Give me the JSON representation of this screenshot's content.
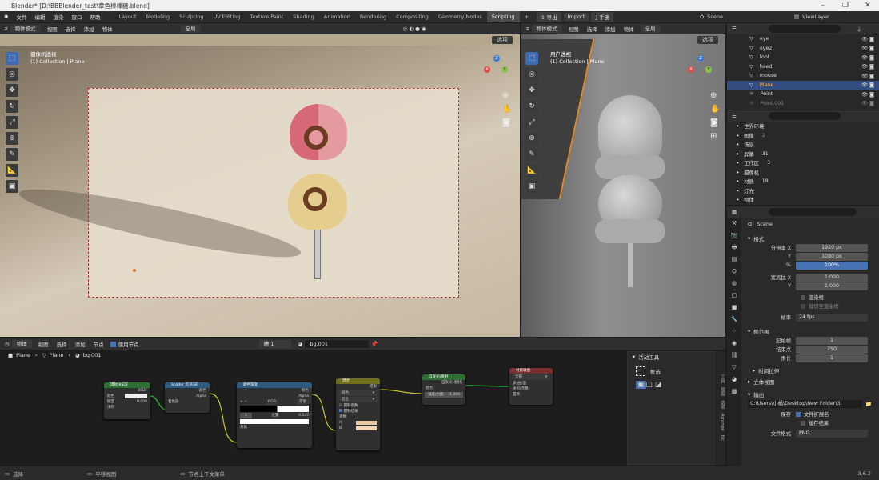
{
  "window": {
    "title": "Blender* [D:\\BBBlender_test\\章鱼棒棒糖.blend]"
  },
  "menu": [
    "文件",
    "编辑",
    "渲染",
    "窗口",
    "帮助"
  ],
  "workspaces": [
    "Layout",
    "Modeling",
    "Sculpting",
    "UV Editing",
    "Texture Paint",
    "Shading",
    "Animation",
    "Rendering",
    "Compositing",
    "Geometry Nodes",
    "Scripting"
  ],
  "active_workspace": "Scripting",
  "topbar": {
    "export": "导出",
    "import": "Import",
    "hand": "手册",
    "scene": "Scene",
    "view_layer": "ViewLayer",
    "add_ws": "+"
  },
  "viewport1": {
    "mode": "物体模式",
    "menus": [
      "视图",
      "选择",
      "添加",
      "物体"
    ],
    "orientation": "全局",
    "options": "选项",
    "view_name": "摄像机透视",
    "collection": "(1) Collection | Plane"
  },
  "viewport2": {
    "mode": "物体模式",
    "menus": [
      "视图",
      "选择",
      "添加",
      "物体"
    ],
    "orientation": "全局",
    "options": "选项",
    "view_name": "用户透视",
    "collection": "(1) Collection | Plane"
  },
  "axes": {
    "x": "X",
    "y": "Y",
    "z": "Z"
  },
  "outliner": {
    "items": [
      {
        "name": "eye",
        "selected": false
      },
      {
        "name": "eye2",
        "selected": false
      },
      {
        "name": "foot",
        "selected": false
      },
      {
        "name": "haed",
        "selected": false
      },
      {
        "name": "mouse",
        "selected": false
      },
      {
        "name": "Plane",
        "selected": true
      },
      {
        "name": "Point",
        "selected": false
      },
      {
        "name": "Point.001",
        "selected": false
      }
    ]
  },
  "data_tree": {
    "items": [
      "世界环境",
      "图像",
      "场景",
      "屏幕",
      "工作区",
      "摄像机",
      "材质",
      "灯光",
      "物体"
    ],
    "counts": [
      "2",
      "",
      "31",
      "3",
      "",
      "18",
      "",
      ""
    ]
  },
  "properties": {
    "scene": "Scene",
    "format_header": "格式",
    "res_x_label": "分辨率 X",
    "res_x": "1920 px",
    "res_y_label": "Y",
    "res_y": "1080 px",
    "pct_label": "%",
    "pct": "100%",
    "aspect_x_label": "宽高比 X",
    "aspect_x": "1.000",
    "aspect_y_label": "Y",
    "aspect_y": "1.000",
    "render_region": "渲染框",
    "crop": "裁切至渲染框",
    "fps_label": "帧率",
    "fps": "24 fps",
    "frame_range_header": "帧范围",
    "start_label": "起始帧",
    "start": "1",
    "end_label": "结束点",
    "end": "250",
    "step_label": "步长",
    "step": "1",
    "time_stretch": "时间拉伸",
    "stereo": "立体视图",
    "output_header": "输出",
    "output_path": "C:\\Users\\小橘\\Desktop\\New Folder\\3",
    "save_label": "保存",
    "file_ext": "文件扩展名",
    "cache": "缓存结果",
    "file_format_label": "文件格式",
    "file_format": "PNG"
  },
  "node_editor": {
    "type": "物体",
    "menus": [
      "视图",
      "选择",
      "添加",
      "节点"
    ],
    "use_nodes": "使用节点",
    "slot": "槽 1",
    "world": "bg.001",
    "breadcrumb": [
      "Plane",
      "Plane",
      "bg.001"
    ],
    "nodes": {
      "bsdf": {
        "title": "漫射 BSDF",
        "out": "BSDF",
        "color": "颜色",
        "rough": "糙度",
        "rough_val": "0.000",
        "normal": "法向"
      },
      "s2rgb": {
        "title": "Shader 到 RGB",
        "in": "着色器",
        "color": "颜色",
        "alpha": "Alpha"
      },
      "ramp": {
        "title": "颜色渐变",
        "color": "颜色",
        "alpha": "Alpha",
        "mode": "RGB",
        "interp": "常值",
        "idx": "1",
        "pos_label": "位置",
        "pos": "0.545",
        "fac": "系数"
      },
      "mix": {
        "title": "混合",
        "out": "结果",
        "type": "颜色",
        "blend": "混合",
        "clamp_f": "钳制系数",
        "clamp_r": "钳制结果",
        "fac": "系数",
        "a": "A",
        "b": "B"
      },
      "emit": {
        "title": "自发光(发射)",
        "out": "自发光(发射)",
        "color": "颜色",
        "strength": "强度/力度",
        "strength_val": "1.000"
      },
      "out": {
        "title": "材质输出",
        "target": "全部",
        "surface": "表(曲)面",
        "volume": "体积(音量)",
        "disp": "置换"
      }
    },
    "sidepanel": {
      "title": "活动工具",
      "tool": "框选",
      "tabs": [
        "工具",
        "视图",
        "选项",
        "Arrange",
        "Nc"
      ]
    }
  },
  "status": {
    "select": "选择",
    "pan": "平移视图",
    "ctx": "节点上下文菜单",
    "version": "3.6.2"
  }
}
